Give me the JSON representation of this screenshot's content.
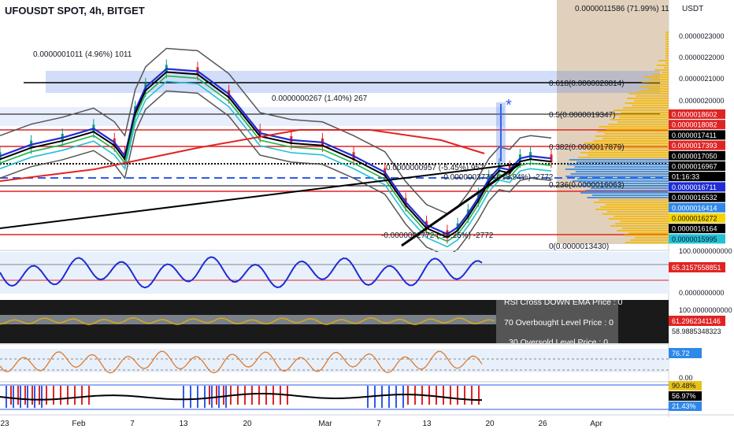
{
  "title": "UFOUSDT SPOT, 4h, BITGET",
  "currency": "USDT",
  "colors": {
    "fib_band": "#4a77e8",
    "support_red": "#e02424",
    "price_up": "#089981",
    "price_down": "#e02424",
    "ema_black": "#000000",
    "ema_red": "#e02424",
    "ema_cyan": "#22c1d6",
    "ema_green": "#1fb34b",
    "ema_blue": "#1f2bd6",
    "ema_yellow": "#d8c81a",
    "bollinger": "#555555",
    "vp_yellow": "#f5b800",
    "vp_blue": "#2f88e8",
    "vp_bg": "#d7c1a5"
  },
  "price_axis": {
    "ticks": [
      "0.0000023000",
      "0.0000022000",
      "0.0000021000",
      "0.0000020000"
    ],
    "badges": [
      {
        "text": "0.0000018602",
        "bg": "#e02424",
        "fg": "#ffffff"
      },
      {
        "text": "0.0000018082",
        "bg": "#e02424",
        "fg": "#ffffff"
      },
      {
        "text": "0.0000017411",
        "bg": "#000000",
        "fg": "#ffffff"
      },
      {
        "text": "0.0000017393",
        "bg": "#e02424",
        "fg": "#ffffff"
      },
      {
        "text": "0.0000017050",
        "bg": "#000000",
        "fg": "#ffffff"
      },
      {
        "text": "0.0000016967",
        "bg": "#000000",
        "fg": "#ffffff"
      },
      {
        "text": "01:16:33",
        "bg": "#000000",
        "fg": "#ffffff"
      },
      {
        "text": "0.0000016711",
        "bg": "#1f2bd6",
        "fg": "#ffffff"
      },
      {
        "text": "0.0000016532",
        "bg": "#000000",
        "fg": "#ffffff"
      },
      {
        "text": "0.0000016414",
        "bg": "#2f88e8",
        "fg": "#ffffff"
      },
      {
        "text": "0.0000016272",
        "bg": "#f5d400",
        "fg": "#131722"
      },
      {
        "text": "0.0000016164",
        "bg": "#000000",
        "fg": "#ffffff"
      },
      {
        "text": "0.0000015995",
        "bg": "#22c1d6",
        "fg": "#131722"
      }
    ]
  },
  "annotations": {
    "top_right": "0.0000011586 (71.99%) 11",
    "top_left": "0.0000001011 (4.96%) 1011",
    "middle": "0.0000000267 (1.40%) 267",
    "fib_618": "0.618(0.0000020814)",
    "fib_5": "0.5(0.0000019347)",
    "fib_382": "0.382(0.0000017879)",
    "fib_236": "0.236(0.0000016063)",
    "fib_0": "0(0.0000013430)",
    "measure_1": "0.0000000957 (-5.45%) 957",
    "measure_2": "-0.0000002772 (-13.94%) -2772",
    "measure_3": "-0.0000002772 (-16.25%) -2772",
    "asterisk": "*"
  },
  "panels": {
    "stoch_rsi": {
      "axis_ticks": [
        "100.0000000000",
        "0.0000000000"
      ],
      "value_badge": {
        "text": "65.3157558851",
        "bg": "#e02424"
      }
    },
    "rsi_ema": {
      "axis_ticks": [
        "100.0000000000"
      ],
      "value_badges": [
        {
          "text": "61.2962341146",
          "bg": "#e02424",
          "fg": "#ffffff"
        },
        {
          "text": "58.9885348323",
          "bg": "#ffffff",
          "fg": "#131722"
        }
      ],
      "info_lines": [
        "RSI Cross DOWN EMA Price : 0",
        "70 Overbought Level Price : 0",
        "30 Oversold Level Price : 0"
      ]
    },
    "stoch": {
      "value_badge": {
        "text": "76.72",
        "bg": "#2f88e8"
      },
      "axis_ticks": [
        "0.00"
      ]
    },
    "wave": {
      "value_badges": [
        {
          "text": "90.48%",
          "bg": "#e8c21a",
          "fg": "#131722"
        },
        {
          "text": "56.97%",
          "bg": "#000000",
          "fg": "#ffffff"
        },
        {
          "text": "21.43%",
          "bg": "#2f88e8",
          "fg": "#ffffff"
        }
      ]
    }
  },
  "time_axis": [
    "23",
    "Feb",
    "7",
    "13",
    "20",
    "Mar",
    "7",
    "13",
    "20",
    "26",
    "Apr"
  ],
  "chart_data": {
    "type": "line",
    "symbol": "UFOUSDT",
    "timeframe": "4h",
    "exchange": "BITGET",
    "x_labels": [
      "23",
      "Feb",
      "7",
      "13",
      "20",
      "Mar",
      "7",
      "13",
      "20",
      "26",
      "Apr"
    ],
    "series": [
      {
        "name": "price",
        "x": [
          0,
          3,
          6,
          9,
          11,
          12,
          13,
          14,
          16,
          19,
          22,
          25,
          28,
          31,
          34,
          37,
          39,
          41,
          43,
          44,
          45,
          46,
          47,
          48,
          49,
          50,
          51,
          53
        ],
        "values": [
          1.7e-06,
          1.75e-06,
          1.78e-06,
          1.82e-06,
          1.76e-06,
          1.7e-06,
          1.9e-06,
          2e-06,
          2.08e-06,
          2.07e-06,
          1.97e-06,
          1.8e-06,
          1.77e-06,
          1.76e-06,
          1.7e-06,
          1.63e-06,
          1.5e-06,
          1.4e-06,
          1.36e-06,
          1.39e-06,
          1.45e-06,
          1.52e-06,
          1.6e-06,
          1.65e-06,
          1.64e-06,
          1.69e-06,
          1.7e-06,
          1.69e-06
        ]
      }
    ],
    "fib_levels": [
      {
        "level": "0.618",
        "price": 2.0814e-06
      },
      {
        "level": "0.5",
        "price": 1.9347e-06
      },
      {
        "level": "0.382",
        "price": 1.7879e-06
      },
      {
        "level": "0.236",
        "price": 1.6063e-06
      },
      {
        "level": "0",
        "price": 1.343e-06
      }
    ],
    "ylim": [
      1.31e-06,
      2.38e-06
    ]
  }
}
